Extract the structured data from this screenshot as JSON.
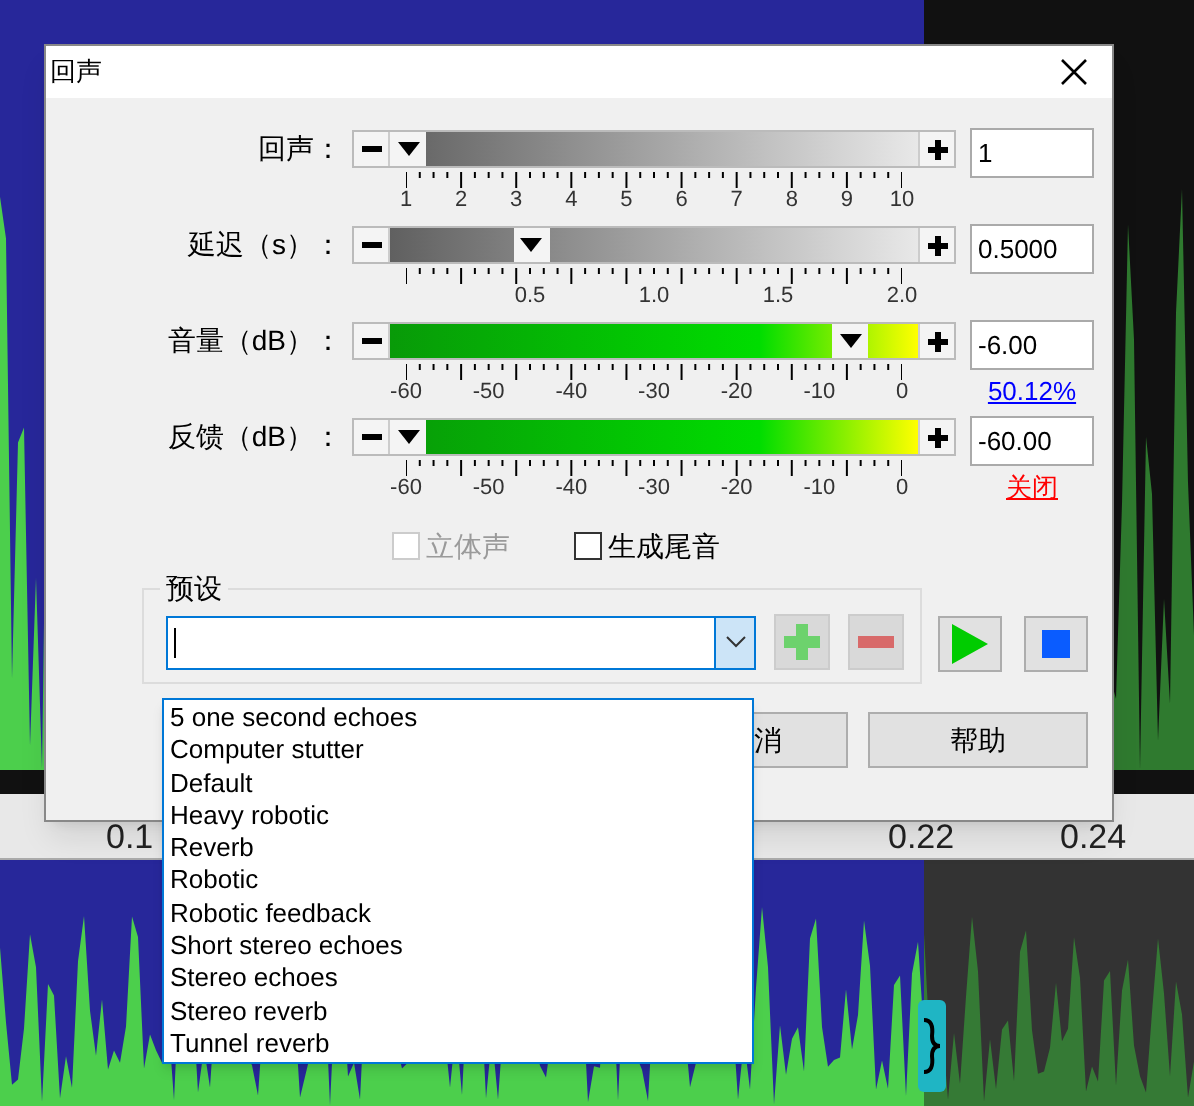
{
  "background": {
    "ruler_labels": [
      "0.1",
      "0.22",
      "0.24"
    ]
  },
  "dialog": {
    "title": "回声",
    "sliders": [
      {
        "label": "回声：",
        "kind": "gray",
        "level": 0,
        "value": "1",
        "origin_labeled": true,
        "tick_labels": [
          "1",
          "2",
          "3",
          "4",
          "5",
          "6",
          "7",
          "8",
          "9",
          "10"
        ]
      },
      {
        "label": "延迟（s）：",
        "kind": "gray",
        "level": 0.25,
        "value": "0.5000",
        "origin_labeled": false,
        "tick_labels": [
          "0.5",
          "1.0",
          "1.5",
          "2.0"
        ]
      },
      {
        "label": "音量（dB）：",
        "kind": "green",
        "level": 0.9,
        "value": "-6.00",
        "origin_labeled": true,
        "tick_labels": [
          "-60",
          "-50",
          "-40",
          "-30",
          "-20",
          "-10",
          "0"
        ],
        "link": {
          "text": "50.12%",
          "color": "#0000ff"
        }
      },
      {
        "label": "反馈（dB）：",
        "kind": "green",
        "level": 0,
        "value": "-60.00",
        "origin_labeled": true,
        "tick_labels": [
          "-60",
          "-50",
          "-40",
          "-30",
          "-20",
          "-10",
          "0"
        ],
        "link": {
          "text": "关闭",
          "color": "#ff0000"
        }
      }
    ],
    "checkboxes": [
      {
        "label": "立体声",
        "checked": false,
        "disabled": true
      },
      {
        "label": "生成尾音",
        "checked": false,
        "disabled": false
      }
    ],
    "presets": {
      "title": "预设",
      "expanded": true,
      "options": [
        "5 one second echoes",
        "Computer stutter",
        "Default",
        "Heavy robotic",
        "Reverb",
        "Robotic",
        "Robotic feedback",
        "Short stereo echoes",
        "Stereo echoes",
        "Stereo reverb",
        "Tunnel reverb"
      ],
      "tools": [
        {
          "kind": "add",
          "disabled": true
        },
        {
          "kind": "remove",
          "disabled": true
        },
        {
          "kind": "play",
          "disabled": false
        },
        {
          "kind": "stop",
          "disabled": false
        }
      ]
    },
    "buttons": [
      {
        "kind": "cancel",
        "label": "消"
      },
      {
        "kind": "help",
        "label": "帮助"
      }
    ]
  }
}
